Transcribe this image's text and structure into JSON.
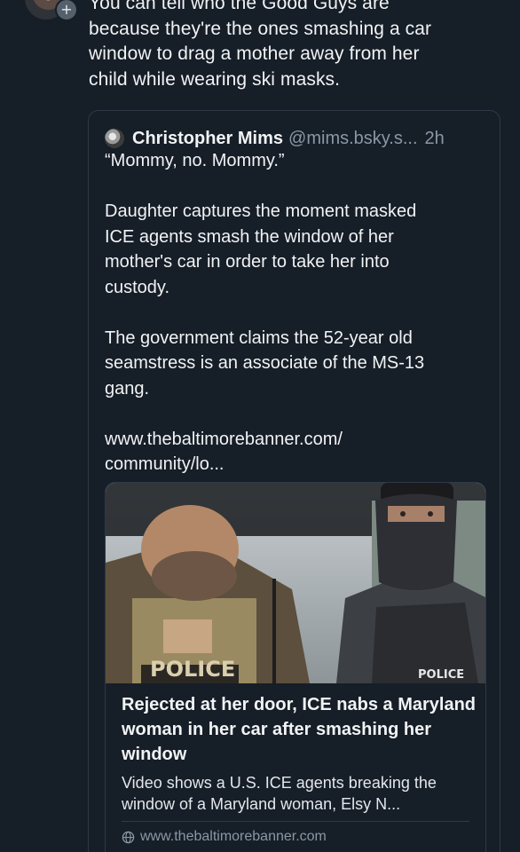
{
  "post": {
    "text": "You can tell who the Good Guys are\nbecause they're the ones smashing a car\nwindow to drag a mother away from her\nchild while wearing ski masks."
  },
  "follow_button": {
    "label": "+"
  },
  "quote": {
    "author_name": "Christopher Mims",
    "author_handle": "@mims.bsky.s...",
    "time": "2h",
    "text": "“Mommy, no. Mommy.”\n\nDaughter captures the moment masked\nICE agents smash the window of her\nmother's car in order to take her into\ncustody.\n\nThe government claims the 52-year old\nseamstress is an associate of the MS-13\ngang.\n\nwww.thebaltimorebanner.com/\ncommunity/lo..."
  },
  "link_card": {
    "image": {
      "vest_label_left": "POLICE",
      "vest_label_right": "POLICE"
    },
    "title": "Rejected at her door, ICE nabs a Maryland woman in her car after smashing her window",
    "description": "Video shows a U.S. ICE agents breaking the window of a Maryland woman, Elsy N...",
    "domain": "www.thebaltimorebanner.com",
    "domain_icon": "globe-icon"
  },
  "colors": {
    "background": "#161e27",
    "border": "#2e3a47",
    "text": "#f1f3f5",
    "muted": "#8a97a6"
  }
}
